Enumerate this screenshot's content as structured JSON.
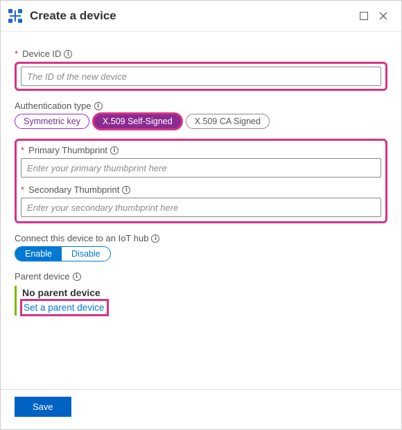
{
  "header": {
    "title": "Create a device"
  },
  "deviceId": {
    "label": "Device ID",
    "placeholder": "The ID of the new device"
  },
  "authType": {
    "label": "Authentication type",
    "options": [
      "Symmetric key",
      "X.509 Self-Signed",
      "X.509 CA Signed"
    ],
    "selectedIndex": 1
  },
  "primaryThumb": {
    "label": "Primary Thumbprint",
    "placeholder": "Enter your primary thumbprint here"
  },
  "secondaryThumb": {
    "label": "Secondary Thumbprint",
    "placeholder": "Enter your secondary thumbprint here"
  },
  "iotHub": {
    "label": "Connect this device to an IoT hub",
    "enable": "Enable",
    "disable": "Disable",
    "enabled": true
  },
  "parent": {
    "label": "Parent device",
    "none": "No parent device",
    "setLink": "Set a parent device"
  },
  "footer": {
    "save": "Save"
  }
}
